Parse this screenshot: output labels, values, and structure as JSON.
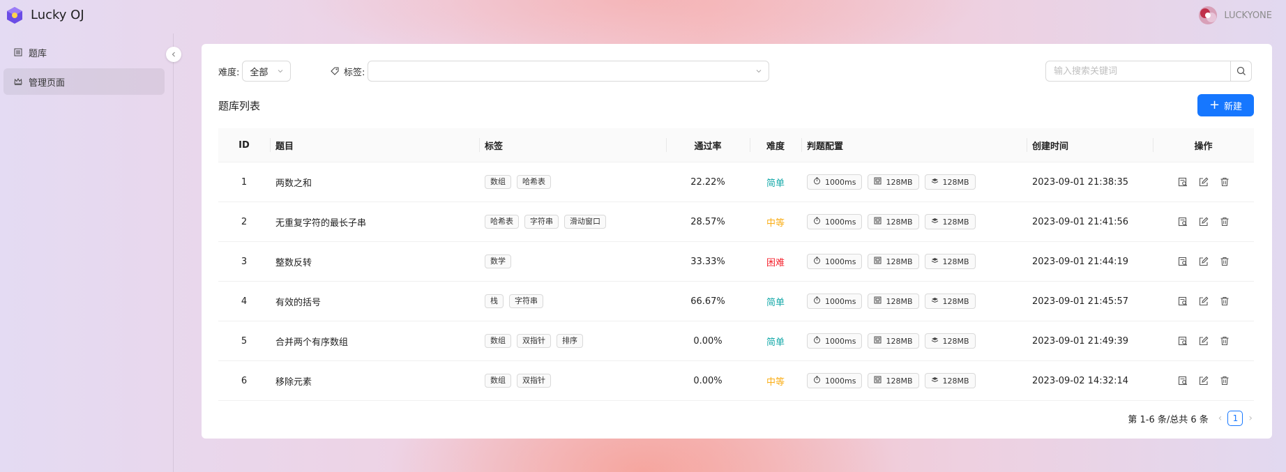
{
  "app": {
    "title": "Lucky OJ"
  },
  "user": {
    "name": "LUCKYONE"
  },
  "sidebar": {
    "items": [
      {
        "label": "题库",
        "icon": "list-icon",
        "active": false
      },
      {
        "label": "管理页面",
        "icon": "crown-icon",
        "active": true
      }
    ]
  },
  "filters": {
    "difficulty_label": "难度:",
    "difficulty_value": "全部",
    "tag_label": "标签:",
    "search_placeholder": "输入搜索关键词"
  },
  "list": {
    "title": "题库列表",
    "new_label": "新建"
  },
  "table": {
    "columns": [
      "ID",
      "题目",
      "标签",
      "通过率",
      "难度",
      "判题配置",
      "创建时间",
      "操作"
    ],
    "rows": [
      {
        "id": "1",
        "title": "两数之和",
        "tags": [
          "数组",
          "哈希表"
        ],
        "rate": "22.22%",
        "difficulty": "简单",
        "time": "1000ms",
        "memory": "128MB",
        "stack": "128MB",
        "created": "2023-09-01 21:38:35"
      },
      {
        "id": "2",
        "title": "无重复字符的最长子串",
        "tags": [
          "哈希表",
          "字符串",
          "滑动窗口"
        ],
        "rate": "28.57%",
        "difficulty": "中等",
        "time": "1000ms",
        "memory": "128MB",
        "stack": "128MB",
        "created": "2023-09-01 21:41:56"
      },
      {
        "id": "3",
        "title": "整数反转",
        "tags": [
          "数学"
        ],
        "rate": "33.33%",
        "difficulty": "困难",
        "time": "1000ms",
        "memory": "128MB",
        "stack": "128MB",
        "created": "2023-09-01 21:44:19"
      },
      {
        "id": "4",
        "title": "有效的括号",
        "tags": [
          "栈",
          "字符串"
        ],
        "rate": "66.67%",
        "difficulty": "简单",
        "time": "1000ms",
        "memory": "128MB",
        "stack": "128MB",
        "created": "2023-09-01 21:45:57"
      },
      {
        "id": "5",
        "title": "合并两个有序数组",
        "tags": [
          "数组",
          "双指针",
          "排序"
        ],
        "rate": "0.00%",
        "difficulty": "简单",
        "time": "1000ms",
        "memory": "128MB",
        "stack": "128MB",
        "created": "2023-09-01 21:49:39"
      },
      {
        "id": "6",
        "title": "移除元素",
        "tags": [
          "数组",
          "双指针"
        ],
        "rate": "0.00%",
        "difficulty": "中等",
        "time": "1000ms",
        "memory": "128MB",
        "stack": "128MB",
        "created": "2023-09-02 14:32:14"
      }
    ]
  },
  "difficulty_colors": {
    "简单": "#13a8a8",
    "中等": "#faad14",
    "困难": "#f5222d"
  },
  "pagination": {
    "summary": "第 1-6 条/总共 6 条",
    "current": "1"
  },
  "colors": {
    "primary": "#1677ff"
  }
}
